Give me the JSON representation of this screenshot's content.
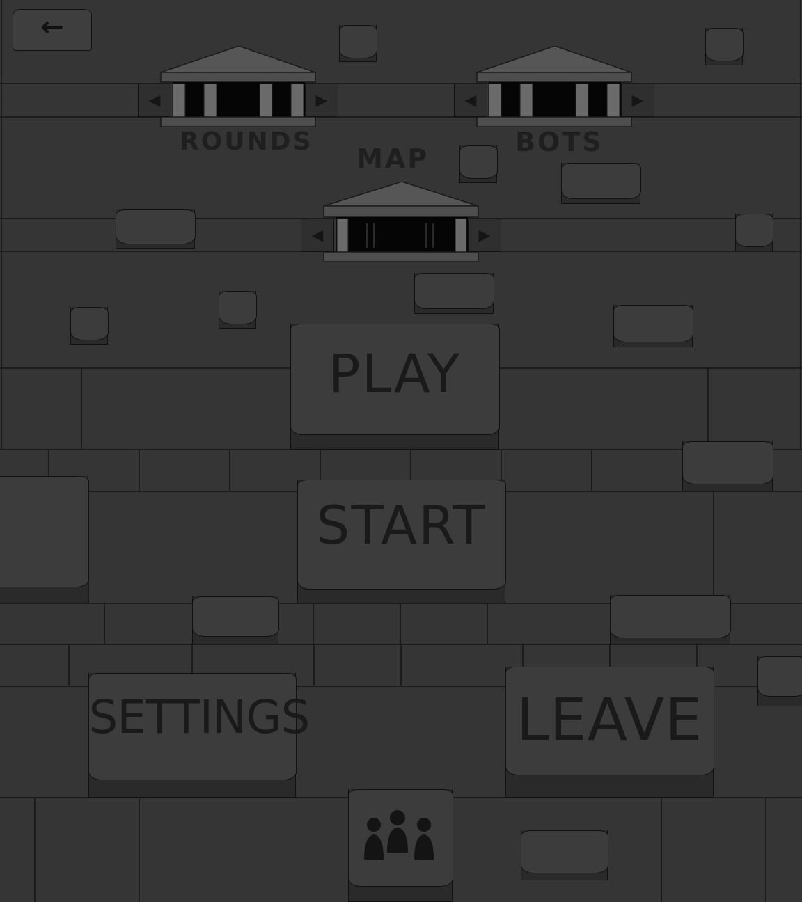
{
  "colors": {
    "background": "#353535",
    "stone_face": "#3c3c3c",
    "stone_side": "#2a2a2a",
    "outline": "#111111",
    "temple_roof": "#555555",
    "temple_pillar": "#6b6b6b",
    "text": "#1a1a1a"
  },
  "header": {
    "back_icon": "←"
  },
  "selectors": {
    "rounds": {
      "label": "ROUNDS"
    },
    "bots": {
      "label": "BOTS"
    },
    "map": {
      "label": "MAP"
    }
  },
  "arrows": {
    "left": "◀",
    "right": "▶"
  },
  "buttons": {
    "play": "PLAY",
    "start": "START",
    "settings": "SETTINGS",
    "leave": "LEAVE"
  },
  "icons": {
    "back": "arrow-left-icon",
    "players": "players-icon",
    "arrow_left": "triangle-left-icon",
    "arrow_right": "triangle-right-icon"
  }
}
